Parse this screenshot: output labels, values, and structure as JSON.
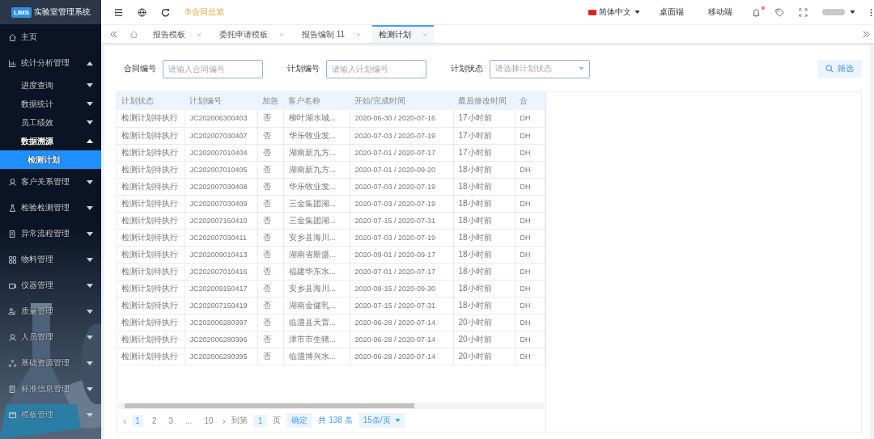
{
  "app": {
    "logo": "LIMS",
    "title": "实验室管理系统"
  },
  "sidebar": {
    "items": [
      {
        "label": "主页",
        "kind": "link",
        "selected": false
      },
      {
        "label": "统计分析管理",
        "kind": "group",
        "selected": false,
        "expanded": true,
        "children": [
          {
            "label": "进度查询",
            "kind": "group",
            "selected": false,
            "expanded": false
          },
          {
            "label": "数据统计",
            "kind": "group",
            "selected": false,
            "expanded": false
          },
          {
            "label": "员工绩效",
            "kind": "group",
            "selected": false,
            "expanded": false
          },
          {
            "label": "数据溯源",
            "kind": "group",
            "selected": false,
            "expanded": true,
            "children": [
              {
                "label": "检测计划",
                "kind": "link",
                "selected": true
              }
            ]
          }
        ]
      },
      {
        "label": "客户关系管理",
        "kind": "group",
        "selected": false,
        "expanded": false
      },
      {
        "label": "检验检测管理",
        "kind": "group",
        "selected": false,
        "expanded": false
      },
      {
        "label": "异常流程管理",
        "kind": "group",
        "selected": false,
        "expanded": false
      },
      {
        "label": "物料管理",
        "kind": "group",
        "selected": false,
        "expanded": false
      },
      {
        "label": "仪器管理",
        "kind": "group",
        "selected": false,
        "expanded": false
      },
      {
        "label": "质量管理",
        "kind": "group",
        "selected": false,
        "expanded": false
      },
      {
        "label": "人员管理",
        "kind": "group",
        "selected": false,
        "expanded": false
      },
      {
        "label": "基础资源管理",
        "kind": "group",
        "selected": false,
        "expanded": false
      },
      {
        "label": "标准信息管理",
        "kind": "group",
        "selected": false,
        "expanded": false
      },
      {
        "label": "模板管理",
        "kind": "group",
        "selected": false,
        "expanded": false
      }
    ]
  },
  "toolbar": {
    "notice": "⑤合同总览",
    "language": "简体中文",
    "links": [
      "桌面端",
      "移动端"
    ],
    "unread": true
  },
  "tabs": [
    {
      "label": "报告模板",
      "selected": false
    },
    {
      "label": "委托申请模板",
      "selected": false
    },
    {
      "label": "报告编制 11",
      "selected": false
    },
    {
      "label": "检测计划",
      "selected": true
    }
  ],
  "filters": [
    {
      "kind": "input",
      "label": "合同编号",
      "placeholder": "请输入合同编号"
    },
    {
      "kind": "input",
      "label": "计划编号",
      "placeholder": "请输入计划编号"
    },
    {
      "kind": "select",
      "label": "计划状态",
      "placeholder": "请选择计划状态"
    }
  ],
  "filter_button": "筛选",
  "table": {
    "columns": [
      "计划状态",
      "计划编号",
      "加急",
      "客户名称",
      "开始/完成时间",
      "最后修改时间",
      "合"
    ],
    "rows": [
      [
        "检测计划待执行",
        "JC202006300403",
        "否",
        "柳叶湖水城...",
        "2020-06-30 / 2020-07-16",
        "17小时前",
        "DH"
      ],
      [
        "检测计划待执行",
        "JC202007030407",
        "否",
        "华乐牧业发...",
        "2020-07-03 / 2020-07-19",
        "17小时前",
        "DH"
      ],
      [
        "检测计划待执行",
        "JC202007010404",
        "否",
        "湖南新九方...",
        "2020-07-01 / 2020-07-17",
        "17小时前",
        "DH"
      ],
      [
        "检测计划待执行",
        "JC202007010405",
        "否",
        "湖南新九方...",
        "2020-07-01 / 2020-09-20",
        "18小时前",
        "DH"
      ],
      [
        "检测计划待执行",
        "JC202007030408",
        "否",
        "华乐牧业发...",
        "2020-07-03 / 2020-07-19",
        "18小时前",
        "DH"
      ],
      [
        "检测计划待执行",
        "JC202007030409",
        "否",
        "三金集团湖...",
        "2020-07-03 / 2020-07-19",
        "18小时前",
        "DH"
      ],
      [
        "检测计划待执行",
        "JC202007150410",
        "否",
        "三金集团湖...",
        "2020-07-15 / 2020-07-31",
        "18小时前",
        "DH"
      ],
      [
        "检测计划待执行",
        "JC202007030411",
        "否",
        "安乡县海川...",
        "2020-07-03 / 2020-07-19",
        "18小时前",
        "DH"
      ],
      [
        "检测计划待执行",
        "JC202009010413",
        "否",
        "湖南省斯盛...",
        "2020-09-01 / 2020-09-17",
        "18小时前",
        "DH"
      ],
      [
        "检测计划待执行",
        "JC202007010416",
        "否",
        "福建华东水...",
        "2020-07-01 / 2020-07-17",
        "18小时前",
        "DH"
      ],
      [
        "检测计划待执行",
        "JC202009150417",
        "否",
        "安乡县海川...",
        "2020-09-15 / 2020-09-30",
        "18小时前",
        "DH"
      ],
      [
        "检测计划待执行",
        "JC202007150419",
        "否",
        "湖南金健乳...",
        "2020-07-15 / 2020-07-31",
        "18小时前",
        "DH"
      ],
      [
        "检测计划待执行",
        "JC202006280397",
        "否",
        "临澧县天置...",
        "2020-06-28 / 2020-07-14",
        "20小时前",
        "DH"
      ],
      [
        "检测计划待执行",
        "JC202006280396",
        "否",
        "津市市生猪...",
        "2020-06-28 / 2020-07-14",
        "20小时前",
        "DH"
      ],
      [
        "检测计划待执行",
        "JC202006280395",
        "否",
        "临澧博兴水...",
        "2020-06-28 / 2020-07-14",
        "20小时前",
        "DH"
      ]
    ]
  },
  "pagination": {
    "prev": "‹",
    "pages": [
      {
        "label": "1",
        "selected": true
      },
      {
        "label": "2",
        "selected": false
      },
      {
        "label": "3",
        "selected": false
      },
      {
        "label": "...",
        "selected": false
      },
      {
        "label": "10",
        "selected": false
      }
    ],
    "next": "›",
    "goto_label": "到第",
    "goto_value": "1",
    "page_unit": "页",
    "confirm": "确定",
    "total": "共 138 条",
    "page_size": "15条/页"
  }
}
